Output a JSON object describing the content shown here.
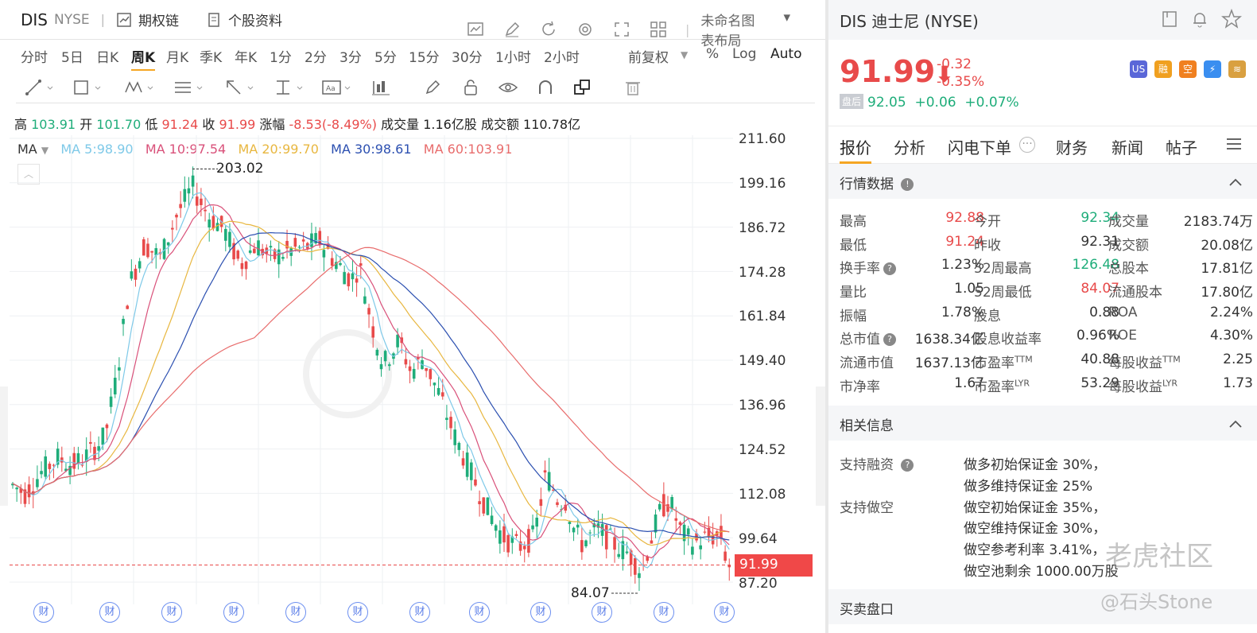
{
  "header": {
    "ticker": "DIS",
    "exchange": "NYSE",
    "options_chain": "期权链",
    "profile": "个股资料",
    "layout_name": "未命名图表布局"
  },
  "periods": [
    "分时",
    "5日",
    "日K",
    "周K",
    "月K",
    "季K",
    "年K",
    "1分",
    "2分",
    "3分",
    "5分",
    "15分",
    "30分",
    "1小时",
    "2小时"
  ],
  "active_period": "周K",
  "adjust": {
    "label": "前复权",
    "pct": "%",
    "log": "Log",
    "auto": "Auto"
  },
  "ohlc": {
    "high_label": "高",
    "high": "103.91",
    "open_label": "开",
    "open": "101.70",
    "low_label": "低",
    "low": "91.24",
    "close_label": "收",
    "close": "91.99",
    "chg_label": "涨幅",
    "chg": "-8.53(-8.49%)",
    "vol_label": "成交量",
    "vol": "1.16亿股",
    "amt_label": "成交额",
    "amt": "110.78亿"
  },
  "ma": {
    "label": "MA",
    "ma5": "MA  5:98.90",
    "ma10": "MA  10:97.54",
    "ma20": "MA  20:99.70",
    "ma30": "MA  30:98.61",
    "ma60": "MA  60:103.91"
  },
  "colors": {
    "up": "#e84a4a",
    "down": "#1fad7a",
    "ma5": "#7ec9e8",
    "ma10": "#d9517a",
    "ma20": "#e8b740",
    "ma30": "#2b4fb0",
    "ma60": "#e86c6c"
  },
  "chart_data": {
    "type": "candlestick",
    "yticks": [
      "211.60",
      "199.16",
      "186.72",
      "174.28",
      "161.84",
      "149.40",
      "136.96",
      "124.52",
      "112.08",
      "99.64",
      "87.20"
    ],
    "ylim": [
      87.2,
      211.6
    ],
    "high_marker": "203.02",
    "low_marker": "84.07",
    "last_price": "91.99",
    "earnings_marker": "财"
  },
  "quote": {
    "title": "DIS 迪士尼 (NYSE)",
    "price": "91.99",
    "arrow": "⬇",
    "change": "-0.32",
    "change_pct": "-0.35%",
    "after_tag": "盘后",
    "after_price": "92.05",
    "after_change": "+0.06",
    "after_pct": "+0.07%"
  },
  "badges": [
    {
      "text": "US",
      "color": "#5a67d8"
    },
    {
      "text": "融",
      "color": "#f0a020"
    },
    {
      "text": "空",
      "color": "#f08020"
    },
    {
      "text": "⚡",
      "color": "#3a8ef0"
    },
    {
      "text": "≋",
      "color": "#d9a040"
    }
  ],
  "tabs": [
    "报价",
    "分析",
    "闪电下单",
    "财务",
    "新闻",
    "帖子"
  ],
  "market_section": "行情数据",
  "market_rows": [
    [
      [
        "最高",
        "92.88",
        "red"
      ],
      [
        "今开",
        "92.34",
        "green"
      ],
      [
        "成交量",
        "2183.74万",
        ""
      ]
    ],
    [
      [
        "最低",
        "91.24",
        "red"
      ],
      [
        "昨收",
        "92.31",
        ""
      ],
      [
        "成交额",
        "20.08亿",
        ""
      ]
    ],
    [
      [
        "换手率",
        "1.23%",
        ""
      ],
      [
        "52周最高",
        "126.48",
        "green"
      ],
      [
        "总股本",
        "17.81亿",
        ""
      ]
    ],
    [
      [
        "量比",
        "1.05",
        ""
      ],
      [
        "52周最低",
        "84.07",
        "red"
      ],
      [
        "流通股本",
        "17.80亿",
        ""
      ]
    ],
    [
      [
        "振幅",
        "1.78%",
        ""
      ],
      [
        "股息",
        "0.88",
        ""
      ],
      [
        "ROA",
        "2.24%",
        ""
      ]
    ],
    [
      [
        "总市值",
        "1638.34亿",
        ""
      ],
      [
        "股息收益率",
        "0.96%",
        ""
      ],
      [
        "ROE",
        "4.30%",
        ""
      ]
    ],
    [
      [
        "流通市值",
        "1637.13亿",
        ""
      ],
      [
        "市盈率",
        "40.88",
        ""
      ],
      [
        "每股收益",
        "2.25",
        ""
      ]
    ],
    [
      [
        "市净率",
        "1.67",
        ""
      ],
      [
        "市盈率",
        "53.29",
        ""
      ],
      [
        "每股收益",
        "1.73",
        ""
      ]
    ]
  ],
  "superscripts": {
    "ttm": "TTM",
    "lyr": "LYR"
  },
  "related_section": "相关信息",
  "margin_info": {
    "long_label": "支持融资",
    "long_lines": [
      "做多初始保证金 30%，",
      "做多维持保证金 25%"
    ],
    "short_label": "支持做空",
    "short_lines": [
      "做空初始保证金 35%，",
      "做空维持保证金 30%，",
      "做空参考利率 3.41%，",
      "做空池剩余 1000.00万股"
    ]
  },
  "order_book_section": "买卖盘口",
  "watermarks": {
    "brand": "老虎社区",
    "user": "@石头Stone"
  }
}
